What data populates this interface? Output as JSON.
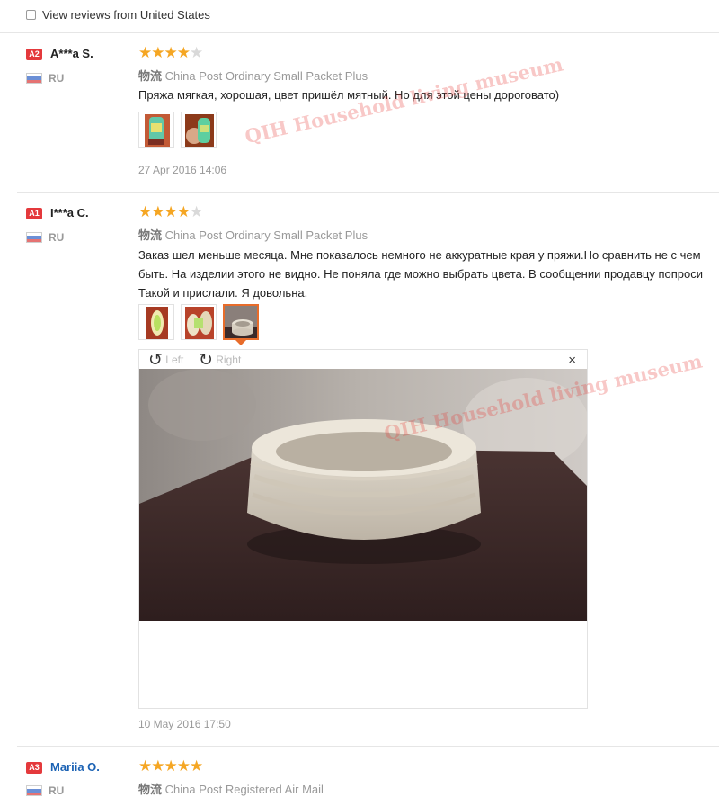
{
  "filter": {
    "view_us_label": "View reviews from United States"
  },
  "reviews": [
    {
      "level": "A2",
      "name": "A***a S.",
      "country": "RU",
      "rating": 4,
      "shipping_label": "物流",
      "shipping_method": "China Post Ordinary Small Packet Plus",
      "text_lines": [
        "Пряжа мягкая, хорошая, цвет пришёл мятный. Но для этой цены дороговато)"
      ],
      "photo_count": 2,
      "date": "27 Apr 2016 14:06"
    },
    {
      "level": "A1",
      "name": "I***a C.",
      "country": "RU",
      "rating": 4,
      "shipping_label": "物流",
      "shipping_method": "China Post Ordinary Small Packet Plus",
      "text_lines": [
        "Заказ шел меньше месяца. Мне показалось немного не аккуратные края у пряжи.Но сравнить не с чем",
        "быть. На изделии этого не видно. Не поняла где можно выбрать цвета. В сообщении продавцу попроси",
        "Такой и прислали. Я довольна."
      ],
      "photo_count": 3,
      "date": "10 May 2016 17:50"
    },
    {
      "level": "A3",
      "name": "Mariia O.",
      "country": "RU",
      "rating": 5,
      "shipping_label": "物流",
      "shipping_method": "China Post Registered Air Mail"
    }
  ],
  "viewer": {
    "left_label": "Left",
    "right_label": "Right",
    "close_label": "×"
  },
  "watermark": {
    "text": "QIH Household living museum"
  },
  "icons": {
    "rotate_left": "rotate-left-icon",
    "rotate_right": "rotate-right-icon",
    "close": "close-icon",
    "star_full": "star-icon",
    "star_empty": "star-empty-icon",
    "flag": "russia-flag-icon"
  },
  "colors": {
    "badge": "#e4393c",
    "star": "#f5a623",
    "star_empty": "#d9d9d9",
    "link": "#1b62b4",
    "active_thumb": "#e86c2a",
    "muted": "#999999"
  }
}
